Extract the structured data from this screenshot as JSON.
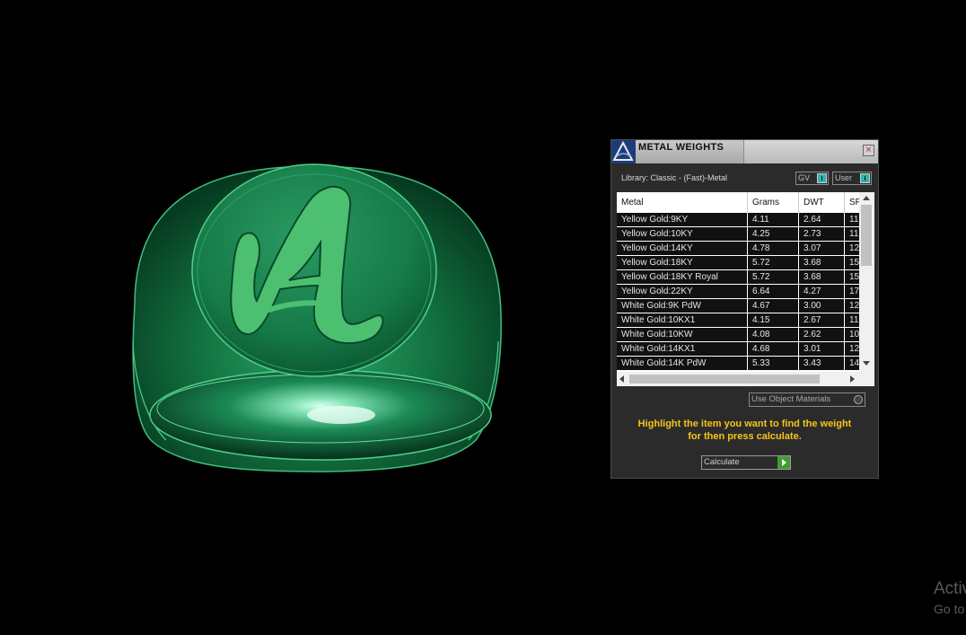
{
  "panel": {
    "title": "METAL WEIGHTS",
    "close_glyph": "×",
    "library_label": "Library: Classic - (Fast)-Metal",
    "toggles": [
      "GV",
      "User"
    ],
    "columns": [
      "Metal",
      "Grams",
      "DWT",
      "SP"
    ],
    "rows": [
      {
        "metal": "Yellow Gold:9KY",
        "grams": "4.11",
        "dwt": "2.64",
        "sp": "11"
      },
      {
        "metal": "Yellow Gold:10KY",
        "grams": "4.25",
        "dwt": "2.73",
        "sp": "11"
      },
      {
        "metal": "Yellow Gold:14KY",
        "grams": "4.78",
        "dwt": "3.07",
        "sp": "12"
      },
      {
        "metal": "Yellow Gold:18KY",
        "grams": "5.72",
        "dwt": "3.68",
        "sp": "15"
      },
      {
        "metal": "Yellow Gold:18KY Royal",
        "grams": "5.72",
        "dwt": "3.68",
        "sp": "15"
      },
      {
        "metal": "Yellow Gold:22KY",
        "grams": "6.64",
        "dwt": "4.27",
        "sp": "17"
      },
      {
        "metal": "White Gold:9K PdW",
        "grams": "4.67",
        "dwt": "3.00",
        "sp": "12"
      },
      {
        "metal": "White Gold:10KX1",
        "grams": "4.15",
        "dwt": "2.67",
        "sp": "11"
      },
      {
        "metal": "White Gold:10KW",
        "grams": "4.08",
        "dwt": "2.62",
        "sp": "10"
      },
      {
        "metal": "White Gold:14KX1",
        "grams": "4.68",
        "dwt": "3.01",
        "sp": "12"
      },
      {
        "metal": "White Gold:14K PdW",
        "grams": "5.33",
        "dwt": "3.43",
        "sp": "14"
      }
    ],
    "use_object_materials": "Use Object Materials",
    "hint_line1": "Highlight the item you want to find the weight",
    "hint_line2": "for then press calculate.",
    "calculate_label": "Calculate"
  },
  "watermark": {
    "line1": "Activ",
    "line2": "Go to"
  },
  "colors": {
    "ring_dark": "#0d5a35",
    "ring_mid": "#1f8a56",
    "ring_edge": "#4fd08a",
    "letter": "#4cc070",
    "hint": "#f5c518"
  }
}
